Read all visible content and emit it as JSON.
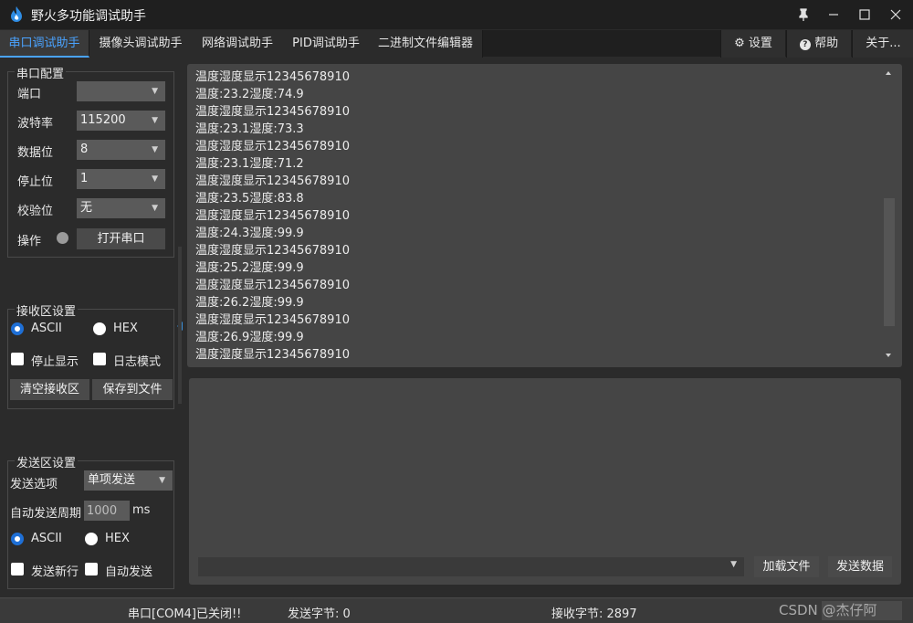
{
  "window": {
    "title": "野火多功能调试助手"
  },
  "tabs": [
    {
      "label": "串口调试助手",
      "active": true
    },
    {
      "label": "摄像头调试助手"
    },
    {
      "label": "网络调试助手"
    },
    {
      "label": "PID调试助手"
    },
    {
      "label": "二进制文件编辑器"
    }
  ],
  "top_buttons": {
    "settings": "设置",
    "help": "帮助",
    "about": "关于..."
  },
  "serial_config": {
    "title": "串口配置",
    "port_label": "端口",
    "port_value": "",
    "baud_label": "波特率",
    "baud_value": "115200",
    "databits_label": "数据位",
    "databits_value": "8",
    "stopbits_label": "停止位",
    "stopbits_value": "1",
    "parity_label": "校验位",
    "parity_value": "无",
    "operation_label": "操作",
    "open_button": "打开串口"
  },
  "receive_settings": {
    "title": "接收区设置",
    "ascii": "ASCII",
    "hex": "HEX",
    "stop_display": "停止显示",
    "log_mode": "日志模式",
    "clear": "清空接收区",
    "save": "保存到文件"
  },
  "send_settings": {
    "title": "发送区设置",
    "send_option_label": "发送选项",
    "send_option_value": "单项发送",
    "auto_period_label": "自动发送周期",
    "auto_period_value": "1000",
    "unit": "ms",
    "ascii": "ASCII",
    "hex": "HEX",
    "send_newline": "发送新行",
    "auto_send": "自动发送"
  },
  "receive_lines": [
    "温度湿度显示12345678910",
    "温度:23.2湿度:74.9",
    "温度湿度显示12345678910",
    "温度:23.1湿度:73.3",
    "温度湿度显示12345678910",
    "温度:23.1湿度:71.2",
    "温度湿度显示12345678910",
    "温度:23.5湿度:83.8",
    "温度湿度显示12345678910",
    "温度:24.3湿度:99.9",
    "温度湿度显示12345678910",
    "温度:25.2湿度:99.9",
    "温度湿度显示12345678910",
    "温度:26.2湿度:99.9",
    "温度湿度显示12345678910",
    "温度:26.9湿度:99.9",
    "温度湿度显示12345678910"
  ],
  "send_bar": {
    "load_file": "加载文件",
    "send_data": "发送数据"
  },
  "status": {
    "port_state": "串口[COM4]已关闭!!",
    "sent_bytes": "发送字节: 0",
    "recv_bytes": "接收字节: 2897",
    "watermark": "CSDN @杰仔阿"
  },
  "colors": {
    "accent": "#4aa3ff",
    "radio_selected": "#1e6fd6"
  }
}
